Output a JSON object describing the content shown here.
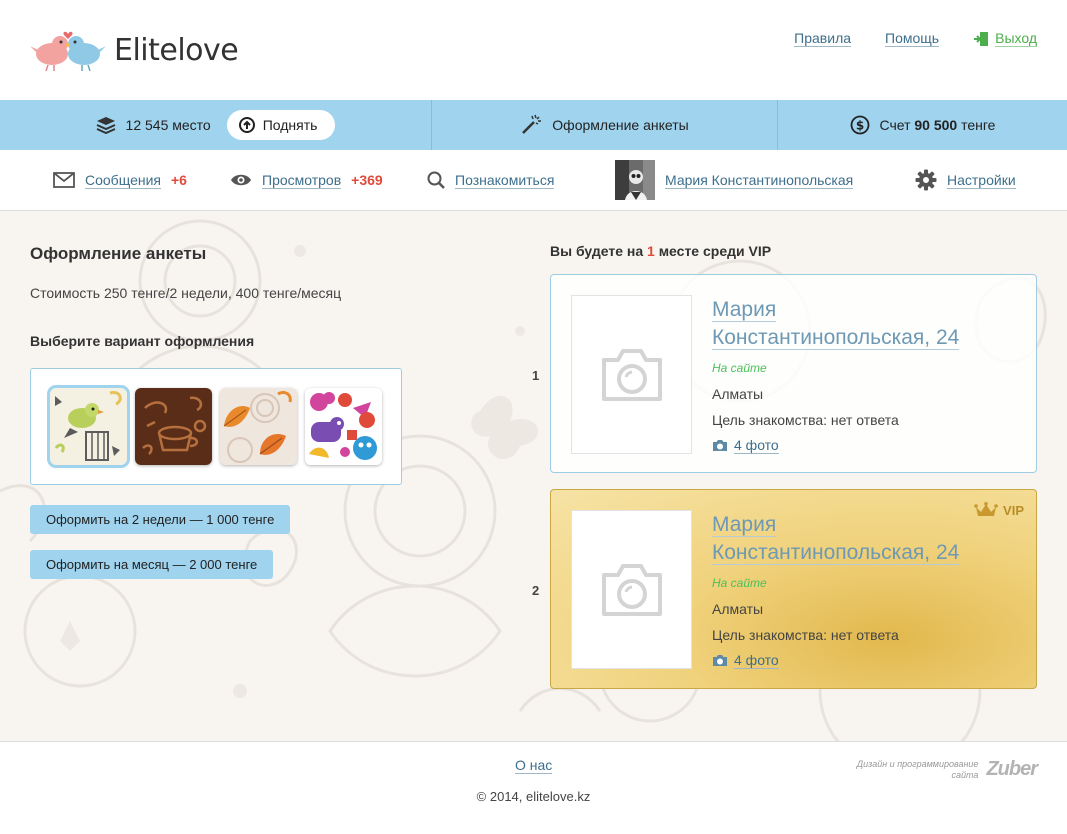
{
  "header": {
    "logo_text": "Elitelove",
    "links": {
      "rules": "Правила",
      "help": "Помощь",
      "exit": "Выход"
    }
  },
  "bluebar": {
    "place_text": "12 545 место",
    "raise_label": "Поднять",
    "design_label": "Оформление анкеты",
    "account_prefix": "Счет",
    "account_amount": "90 500",
    "account_currency": "тенге"
  },
  "nav": {
    "messages_label": "Сообщения",
    "messages_count": "+6",
    "views_label": "Просмотров",
    "views_count": "+369",
    "meet_label": "Познакомиться",
    "profile_name": "Мария Константинопольская",
    "settings_label": "Настройки"
  },
  "main": {
    "title": "Оформление анкеты",
    "price": "Стоимость 250 тенге/2 недели, 400 тенге/месяц",
    "choose_title": "Выберите вариант оформления",
    "btn_two_weeks": "Оформить на 2 недели — 1 000 тенге",
    "btn_month": "Оформить на месяц — 2 000 тенге"
  },
  "vip": {
    "head_prefix": "Вы будете на",
    "head_num": "1",
    "head_suffix": "месте среди VIP",
    "cards": [
      {
        "rank": "1",
        "name_line1": "Мария",
        "name_line2": "Константинопольская, 24",
        "online": "На сайте",
        "city": "Алматы",
        "goal": "Цель знакомства: нет ответа",
        "photos": "4 фото"
      },
      {
        "rank": "2",
        "name_line1": "Мария",
        "name_line2": "Константинопольская, 24",
        "online": "На сайте",
        "city": "Алматы",
        "goal": "Цель знакомства: нет ответа",
        "photos": "4 фото",
        "badge": "VIP"
      }
    ]
  },
  "footer": {
    "about": "О нас",
    "copyright": "© 2014, elitelove.kz",
    "credit_line1": "Дизайн и программирование",
    "credit_line2": "сайта",
    "credit_brand": "Zuber"
  },
  "colors": {
    "bluebar": "#9fd3ee",
    "link": "#3d6f8c",
    "count_red": "#e04a3a",
    "online_green": "#4cbf5a",
    "vip_gold": "#e2b84e"
  }
}
